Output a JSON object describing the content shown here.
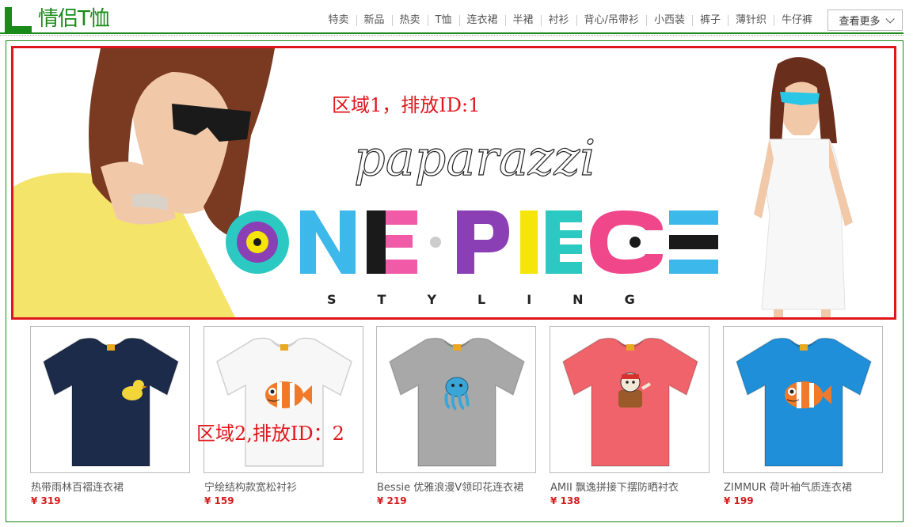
{
  "header": {
    "logo_text": "情侣T恤",
    "nav": [
      "特卖",
      "新品",
      "热卖",
      "T恤",
      "连衣裙",
      "半裙",
      "衬衫",
      "背心/吊带衫",
      "小西装",
      "裤子",
      "薄针织",
      "牛仔裤"
    ],
    "more_label": "查看更多"
  },
  "banner": {
    "region_label": "区域1，排放ID:1",
    "script_word": "paparazzi",
    "title_letters": [
      "O",
      "N",
      "E",
      "·",
      "P",
      "I",
      "E",
      "C",
      "E"
    ],
    "subtitle": "STYLING",
    "colors": {
      "o_outer": "#2bc9c2",
      "o_ring": "#8b3fb5",
      "o_center": "#f5e50a",
      "n": "#3db8ea",
      "e1_left": "#1a1a1a",
      "e1_right": "#f05aa6",
      "dot": "#cccccc",
      "p": "#8b3fb5",
      "i": "#f5e50a",
      "e2": "#2bc9c2",
      "c": "#f0478a",
      "e3_bar": "#1a1a1a",
      "e3": "#3db8ea"
    }
  },
  "region2_label": "区域2,排放ID：2",
  "products": [
    {
      "name": "热带雨林百褶连衣裙",
      "price": "¥ 319",
      "shirt_color": "#1d2b4a",
      "graphic": "duck-icon"
    },
    {
      "name": "宁绘结构款宽松衬衫",
      "price": "¥ 159",
      "shirt_color": "#f7f7f7",
      "graphic": "clownfish-icon"
    },
    {
      "name": "Bessie 优雅浪漫V领印花连衣裙",
      "price": "¥ 219",
      "shirt_color": "#a8a8a8",
      "graphic": "octopus-icon"
    },
    {
      "name": "AMII 飘逸拼接下摆防晒衬衣",
      "price": "¥ 138",
      "shirt_color": "#f0636a",
      "graphic": "sailor-bear-icon"
    },
    {
      "name": "ZIMMUR 荷叶袖气质连衣裙",
      "price": "¥ 199",
      "shirt_color": "#1e8fd8",
      "graphic": "clownfish-icon"
    }
  ]
}
